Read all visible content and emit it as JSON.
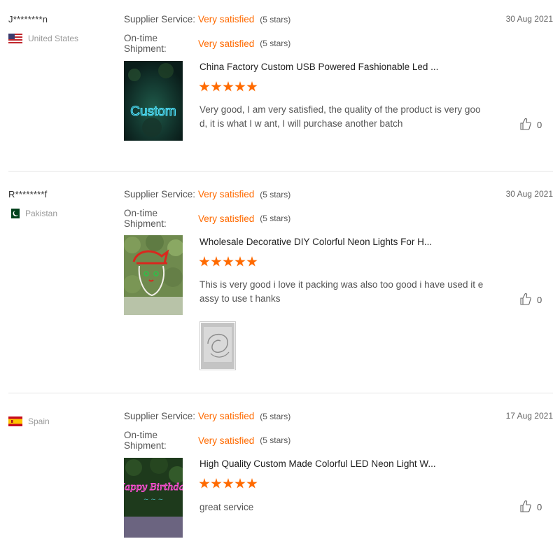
{
  "accent_color": "#ff6a00",
  "reviews": [
    {
      "buyer": "J********n",
      "country": "United States",
      "flag_icon": "us-flag-icon",
      "supplier_label": "Supplier Service:",
      "supplier_value": "Very satisfied",
      "supplier_stars": "(5 stars)",
      "shipment_label": "On-time Shipment:",
      "shipment_value": "Very satisfied",
      "shipment_stars": "(5 stars)",
      "date": "30 Aug 2021",
      "product_title": "China Factory Custom USB Powered Fashionable Led ...",
      "product_image_text": "Custom",
      "rating": 5,
      "text": "Very good, I am very satisfied, the quality of the product is very good, it is what I w ant, I will purchase another batch",
      "likes": "0"
    },
    {
      "buyer": "R********f",
      "country": "Pakistan",
      "flag_icon": "pakistan-flag-icon",
      "supplier_label": "Supplier Service:",
      "supplier_value": "Very satisfied",
      "supplier_stars": "(5 stars)",
      "shipment_label": "On-time Shipment:",
      "shipment_value": "Very satisfied",
      "shipment_stars": "(5 stars)",
      "date": "30 Aug 2021",
      "product_title": "Wholesale Decorative DIY Colorful Neon Lights For H...",
      "rating": 5,
      "text": "This is very good i love it packing was also too good i have used it eassy to use  t hanks",
      "likes": "0"
    },
    {
      "buyer": "",
      "country": "Spain",
      "flag_icon": "spain-flag-icon",
      "supplier_label": "Supplier Service:",
      "supplier_value": "Very satisfied",
      "supplier_stars": "(5 stars)",
      "shipment_label": "On-time Shipment:",
      "shipment_value": "Very satisfied",
      "shipment_stars": "(5 stars)",
      "date": "17 Aug 2021",
      "product_title": "High Quality Custom Made Colorful LED Neon Light W...",
      "product_image_text": "Happy Birthday",
      "rating": 5,
      "text": "great service",
      "likes": "0"
    }
  ]
}
